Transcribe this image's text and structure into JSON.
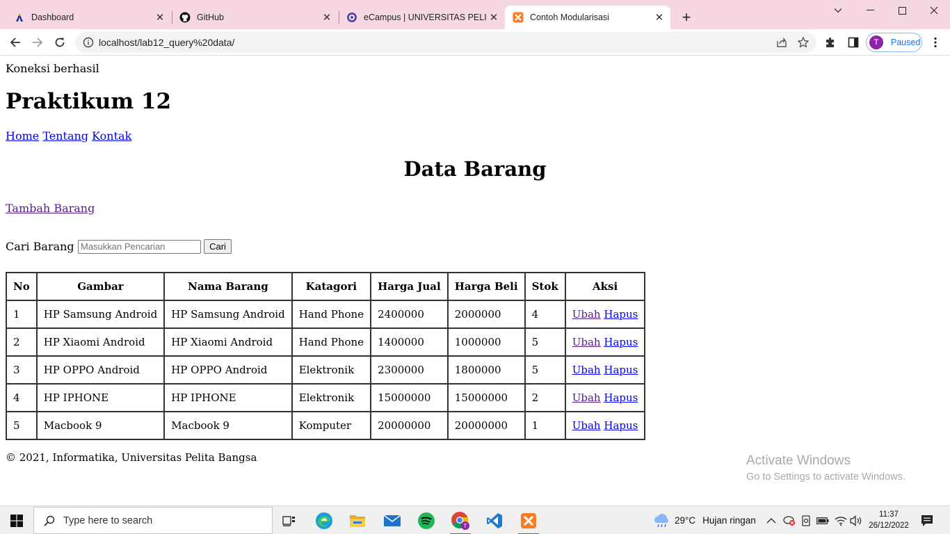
{
  "browser": {
    "tabs": [
      {
        "title": "Dashboard",
        "icon": "dashboard-favicon-icon"
      },
      {
        "title": "GitHub",
        "icon": "github-icon"
      },
      {
        "title": "eCampus | UNIVERSITAS PELITA BANGSA",
        "icon": "ecampus-favicon-icon"
      },
      {
        "title": "Contoh Modularisasi",
        "icon": "xampp-favicon-icon",
        "active": true
      }
    ],
    "url": "localhost/lab12_query%20data/",
    "profile_initial": "T",
    "profile_status": "Paused"
  },
  "page": {
    "connection_status": "Koneksi berhasil",
    "heading": "Praktikum 12",
    "nav": [
      "Home",
      "Tentang",
      "Kontak"
    ],
    "section_title": "Data Barang",
    "add_link": "Tambah Barang",
    "search_label": "Cari Barang",
    "search_placeholder": "Masukkan Pencarian",
    "search_button": "Cari",
    "table": {
      "headers": [
        "No",
        "Gambar",
        "Nama Barang",
        "Katagori",
        "Harga Jual",
        "Harga Beli",
        "Stok",
        "Aksi"
      ],
      "rows": [
        {
          "no": "1",
          "gambar": "HP Samsung Android",
          "nama": "HP Samsung Android",
          "kategori": "Hand Phone",
          "jual": "2400000",
          "beli": "2000000",
          "stok": "4"
        },
        {
          "no": "2",
          "gambar": "HP Xiaomi Android",
          "nama": "HP Xiaomi Android",
          "kategori": "Hand Phone",
          "jual": "1400000",
          "beli": "1000000",
          "stok": "5"
        },
        {
          "no": "3",
          "gambar": "HP OPPO Android",
          "nama": "HP OPPO Android",
          "kategori": "Elektronik",
          "jual": "2300000",
          "beli": "1800000",
          "stok": "5"
        },
        {
          "no": "4",
          "gambar": "HP IPHONE",
          "nama": "HP IPHONE",
          "kategori": "Elektronik",
          "jual": "15000000",
          "beli": "15000000",
          "stok": "2"
        },
        {
          "no": "5",
          "gambar": "Macbook 9",
          "nama": "Macbook 9",
          "kategori": "Komputer",
          "jual": "20000000",
          "beli": "20000000",
          "stok": "1"
        }
      ],
      "action_edit": "Ubah",
      "action_delete": "Hapus"
    },
    "footer": "© 2021, Informatika, Universitas Pelita Bangsa"
  },
  "watermark": {
    "line1": "Activate Windows",
    "line2": "Go to Settings to activate Windows."
  },
  "taskbar": {
    "search_placeholder": "Type here to search",
    "apps": [
      "task-view-icon",
      "edge-icon",
      "file-explorer-icon",
      "mail-icon",
      "spotify-icon",
      "chrome-icon",
      "vscode-icon",
      "xampp-icon"
    ],
    "weather_temp": "29°C",
    "weather_desc": "Hujan ringan",
    "time": "11:37",
    "date": "26/12/2022"
  },
  "colors": {
    "tabstrip_bg": "#f6d7e3",
    "link": "#0000ee",
    "visited_link": "#551a8b",
    "profile_accent": "#8e24aa"
  }
}
